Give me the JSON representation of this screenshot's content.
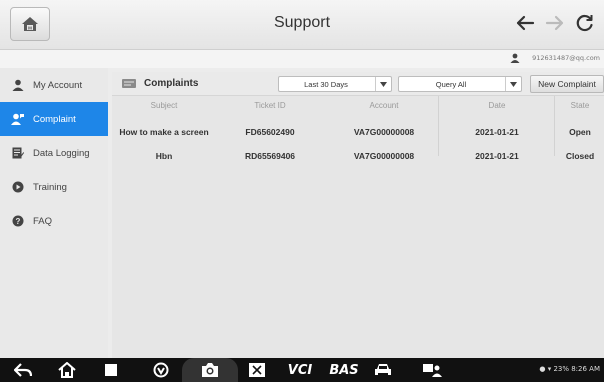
{
  "header": {
    "title": "Support",
    "user_email": "912631487@qq.com"
  },
  "sidebar": {
    "items": [
      {
        "label": "My Account",
        "icon": "user-icon"
      },
      {
        "label": "Complaint",
        "icon": "complaint-icon",
        "active": true
      },
      {
        "label": "Data Logging",
        "icon": "data-logging-icon"
      },
      {
        "label": "Training",
        "icon": "training-icon"
      },
      {
        "label": "FAQ",
        "icon": "faq-icon"
      }
    ]
  },
  "toolbar": {
    "title": "Complaints",
    "period": "Last 30 Days",
    "query": "Query All",
    "new_button": "New Complaint"
  },
  "table": {
    "columns": [
      "Subject",
      "Ticket ID",
      "Account",
      "Date",
      "State"
    ],
    "rows": [
      [
        "How to make a screen",
        "FD65602490",
        "VA7G00000008",
        "2021-01-21",
        "Open"
      ],
      [
        "Hbn",
        "RD65569406",
        "VA7G00000008",
        "2021-01-21",
        "Closed"
      ]
    ]
  },
  "navbar": {
    "vci_label": "VCI",
    "bas_label": "BAS",
    "status": "23% 8:26 AM"
  },
  "colors": {
    "accent": "#1e86e8",
    "header_bg": "#ececec",
    "navbar_bg": "#111111"
  }
}
